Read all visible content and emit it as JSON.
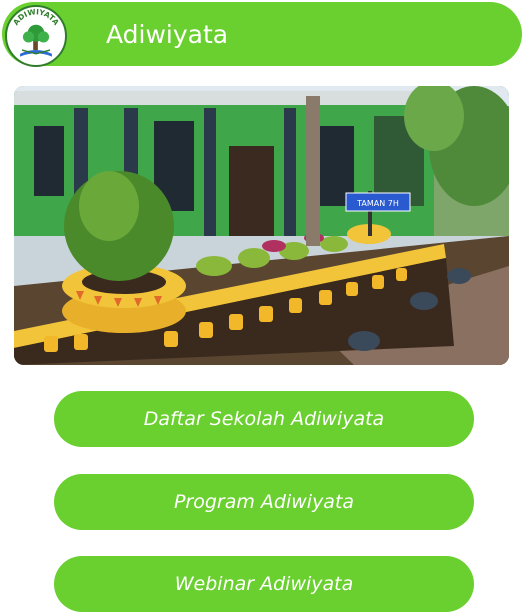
{
  "header": {
    "title": "Adiwiyata",
    "logo_text": "ADIWIYATA",
    "accent_color": "#6ad02f"
  },
  "photo": {
    "sign_text": "TAMAN 7H"
  },
  "menu": [
    {
      "label": "Daftar Sekolah Adiwiyata"
    },
    {
      "label": "Program Adiwiyata"
    },
    {
      "label": "Webinar Adiwiyata"
    }
  ]
}
